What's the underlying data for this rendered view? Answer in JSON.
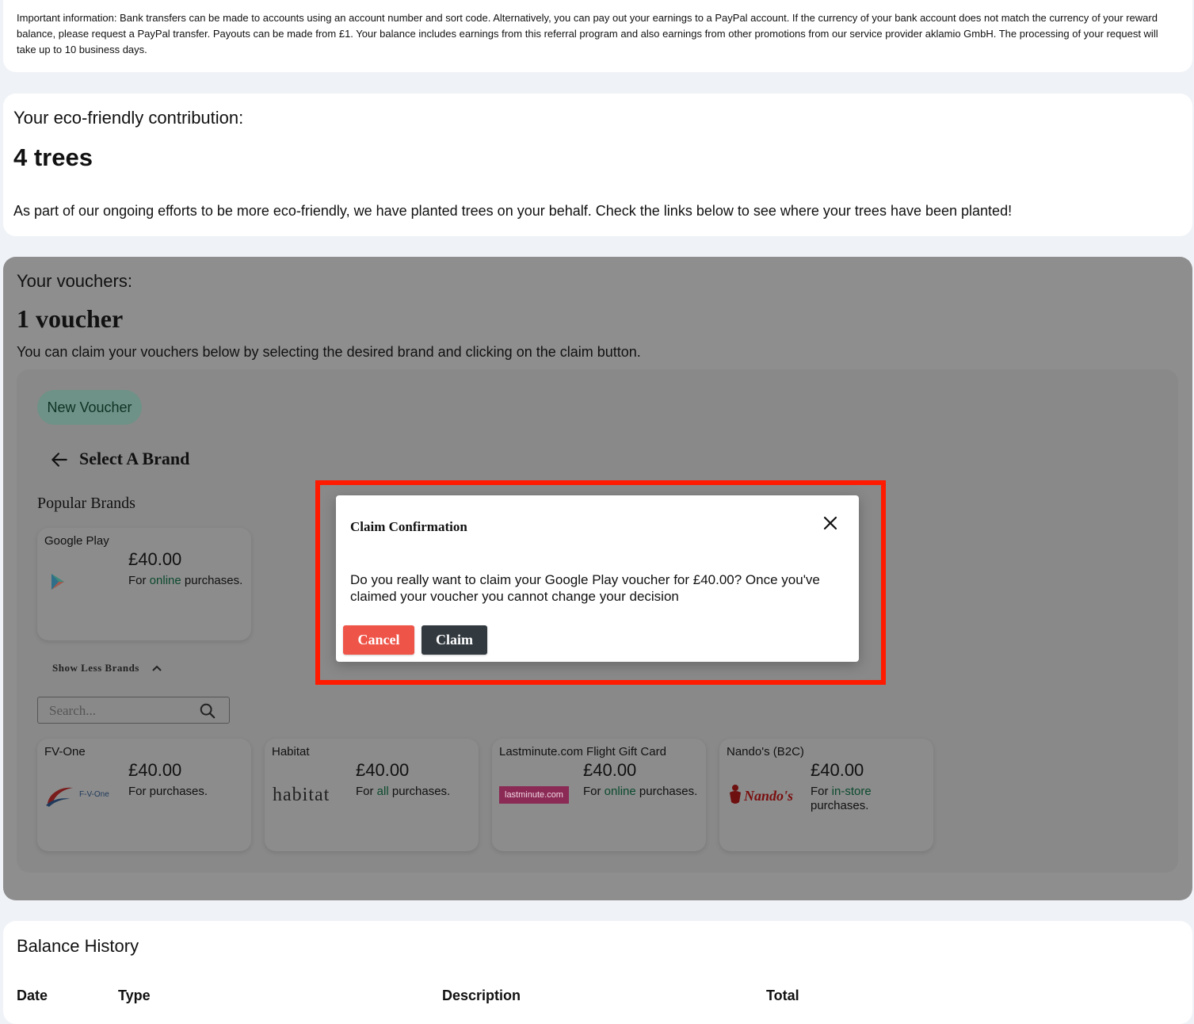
{
  "info": {
    "text": "Important information: Bank transfers can be made to accounts using an account number and sort code. Alternatively, you can pay out your earnings to a PayPal account. If the currency of your bank account does not match the currency of your reward balance, please request a PayPal transfer. Payouts can be made from £1. Your balance includes earnings from this referral program and also earnings from other promotions from our service provider aklamio GmbH. The processing of your request will take up to 10 business days."
  },
  "eco": {
    "title": "Your eco-friendly contribution:",
    "count": "4 trees",
    "text": "As part of our ongoing efforts to be more eco-friendly, we have planted trees on your behalf. Check the links below to see where your trees have been planted!"
  },
  "vouchers": {
    "title": "Your vouchers:",
    "count": "1 voucher",
    "description": "You can claim your vouchers below by selecting the desired brand and clicking on the claim button.",
    "new_voucher_label": "New Voucher",
    "select_brand_label": "Select A Brand",
    "popular_brands_label": "Popular Brands",
    "show_less_label": "Show Less Brands",
    "search_placeholder": "Search...",
    "popular": [
      {
        "name": "Google Play",
        "amount": "£40.00",
        "desc_pre": "For ",
        "desc_hl": "online",
        "desc_post": " purchases.",
        "logo_text": "Google Play"
      }
    ],
    "brands": [
      {
        "name": "FV-One",
        "amount": "£40.00",
        "desc_pre": "For purchases.",
        "desc_hl": "",
        "desc_post": "",
        "logo_text": "F-V-One"
      },
      {
        "name": "Habitat",
        "amount": "£40.00",
        "desc_pre": "For ",
        "desc_hl": "all",
        "desc_post": " purchases.",
        "logo_text": "habitat"
      },
      {
        "name": "Lastminute.com Flight Gift Card",
        "amount": "£40.00",
        "desc_pre": "For ",
        "desc_hl": "online",
        "desc_post": " purchases.",
        "logo_text": "lastminute.com"
      },
      {
        "name": "Nando's (B2C)",
        "amount": "£40.00",
        "desc_pre": "For ",
        "desc_hl": "in-store",
        "desc_post": " purchases.",
        "logo_text": "Nando's"
      }
    ]
  },
  "modal": {
    "title": "Claim Confirmation",
    "body": "Do you really want to claim your Google Play voucher for £40.00? Once you've claimed your voucher you cannot change your decision",
    "cancel_label": "Cancel",
    "claim_label": "Claim"
  },
  "balance": {
    "title": "Balance History",
    "columns": [
      "Date",
      "Type",
      "Description",
      "Total"
    ]
  },
  "colors": {
    "highlight": "#ff1a00",
    "cancel": "#ef5448",
    "claim": "#323a40",
    "new_voucher_bg": "#6e9287",
    "link_green": "#0b4a2e"
  }
}
